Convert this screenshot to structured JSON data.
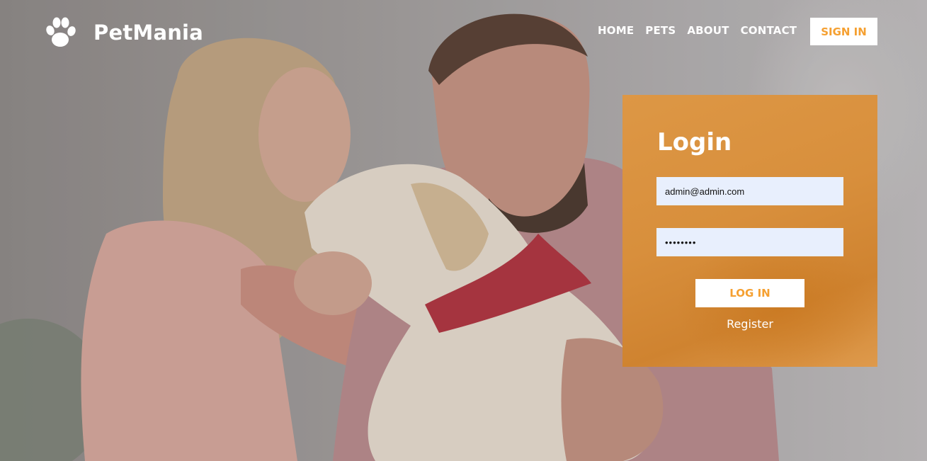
{
  "brand": {
    "name": "PetMania",
    "logo_icon": "paw-icon"
  },
  "nav": {
    "items": [
      {
        "label": "HOME"
      },
      {
        "label": "PETS"
      },
      {
        "label": "ABOUT"
      },
      {
        "label": "CONTACT"
      }
    ],
    "signin_label": "SIGN IN"
  },
  "login": {
    "title": "Login",
    "email_value": "admin@admin.com",
    "password_value": "••••••••",
    "submit_label": "LOG IN",
    "register_label": "Register"
  },
  "colors": {
    "accent": "#f5a031",
    "panel": "#d88f3c",
    "input_bg": "#e8effd",
    "text_light": "#ffffff"
  },
  "hero_image": "couple-with-dog-photo"
}
